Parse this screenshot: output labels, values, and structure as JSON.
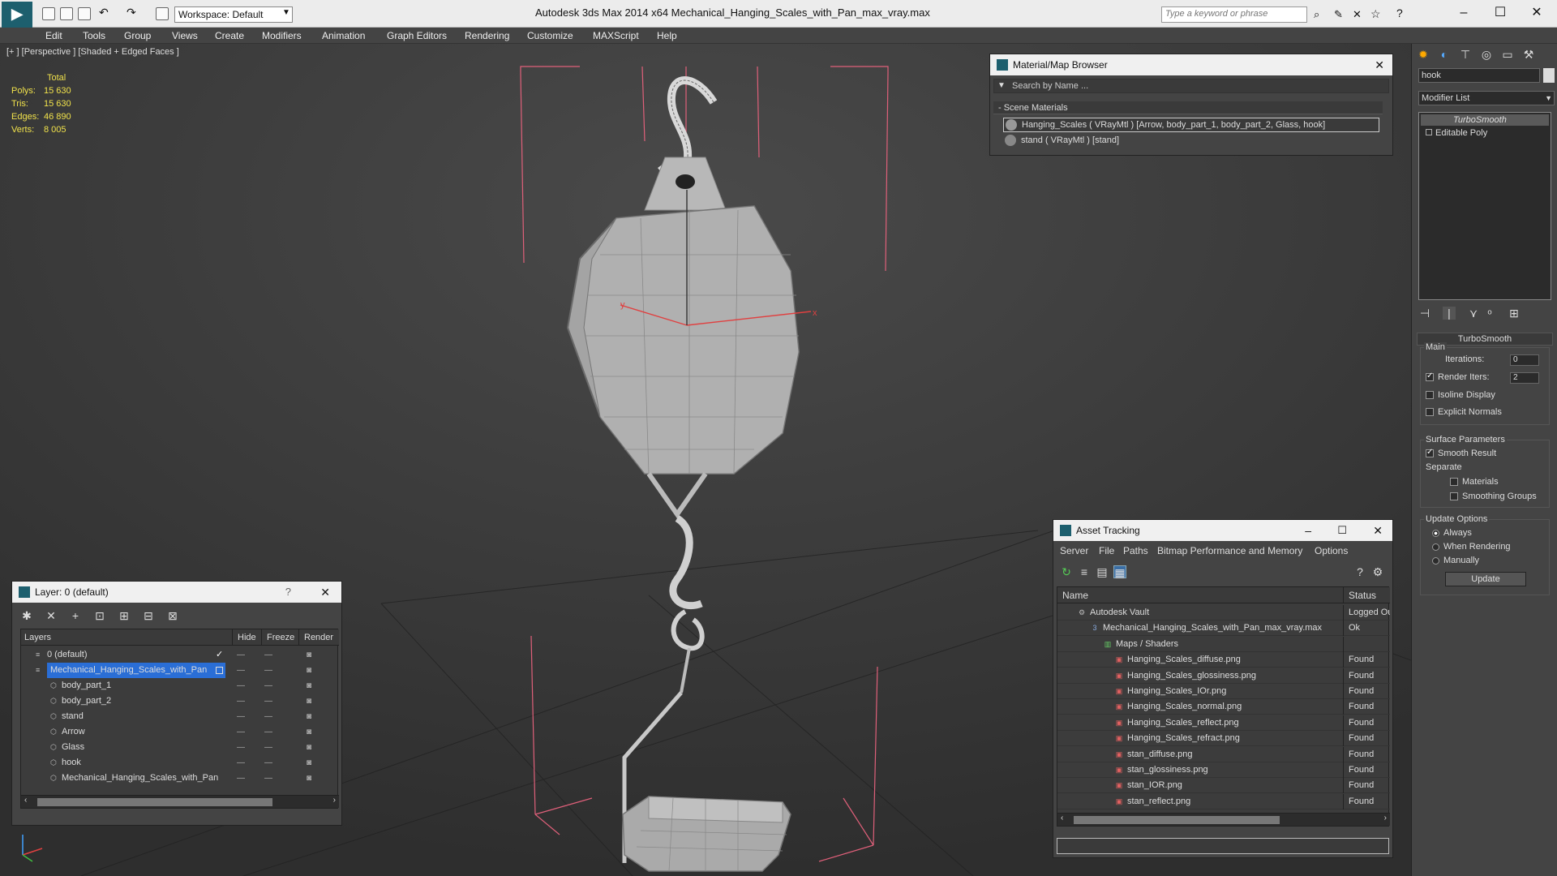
{
  "app": {
    "title": "Autodesk 3ds Max  2014 x64      Mechanical_Hanging_Scales_with_Pan_max_vray.max",
    "workspace_label": "Workspace: Default",
    "search_placeholder": "Type a keyword or phrase"
  },
  "menu": [
    "Edit",
    "Tools",
    "Group",
    "Views",
    "Create",
    "Modifiers",
    "Animation",
    "Graph Editors",
    "Rendering",
    "Customize",
    "MAXScript",
    "Help"
  ],
  "viewport": {
    "label": "[+ ] [Perspective ] [Shaded + Edged Faces ]",
    "stats": {
      "header": "Total",
      "polys_label": "Polys:",
      "polys": "15 630",
      "tris_label": "Tris:",
      "tris": "15 630",
      "edges_label": "Edges:",
      "edges": "46 890",
      "verts_label": "Verts:",
      "verts": "8 005"
    },
    "axis_x": "x",
    "axis_y": "y"
  },
  "material_browser": {
    "title": "Material/Map Browser",
    "search_placeholder": "Search by Name ...",
    "section": "- Scene Materials",
    "items": [
      "Hanging_Scales ( VRayMtl ) [Arrow, body_part_1, body_part_2, Glass, hook]",
      "stand ( VRayMtl ) [stand]"
    ]
  },
  "layer_panel": {
    "title": "Layer: 0 (default)",
    "help": "?",
    "columns": {
      "layers": "Layers",
      "hide": "Hide",
      "freeze": "Freeze",
      "render": "Render"
    },
    "rows": [
      "0 (default)",
      "Mechanical_Hanging_Scales_with_Pan",
      "body_part_1",
      "body_part_2",
      "stand",
      "Arrow",
      "Glass",
      "hook",
      "Mechanical_Hanging_Scales_with_Pan"
    ]
  },
  "asset_tracking": {
    "title": "Asset Tracking",
    "menu": [
      "Server",
      "File",
      "Paths",
      "Bitmap Performance and Memory",
      "Options"
    ],
    "columns": {
      "name": "Name",
      "status": "Status"
    },
    "rows": [
      {
        "name": "Autodesk Vault",
        "status": "Logged Ou"
      },
      {
        "name": "Mechanical_Hanging_Scales_with_Pan_max_vray.max",
        "status": "Ok"
      },
      {
        "name": "Maps / Shaders",
        "status": ""
      },
      {
        "name": "Hanging_Scales_diffuse.png",
        "status": "Found"
      },
      {
        "name": "Hanging_Scales_glossiness.png",
        "status": "Found"
      },
      {
        "name": "Hanging_Scales_IOr.png",
        "status": "Found"
      },
      {
        "name": "Hanging_Scales_normal.png",
        "status": "Found"
      },
      {
        "name": "Hanging_Scales_reflect.png",
        "status": "Found"
      },
      {
        "name": "Hanging_Scales_refract.png",
        "status": "Found"
      },
      {
        "name": "stan_diffuse.png",
        "status": "Found"
      },
      {
        "name": "stan_glossiness.png",
        "status": "Found"
      },
      {
        "name": "stan_IOR.png",
        "status": "Found"
      },
      {
        "name": "stan_reflect.png",
        "status": "Found"
      }
    ]
  },
  "command_panel": {
    "object_name": "hook",
    "modifier_list": "Modifier List",
    "stack": [
      "TurboSmooth",
      "Editable Poly"
    ],
    "rollout_title": "TurboSmooth",
    "main_group": "Main",
    "iterations_label": "Iterations:",
    "iterations": "0",
    "render_iters_label": "Render Iters:",
    "render_iters": "2",
    "isoline": "Isoline Display",
    "explicit_normals": "Explicit Normals",
    "surface_params": "Surface Parameters",
    "smooth_result": "Smooth Result",
    "separate": "Separate",
    "materials": "Materials",
    "smoothing_groups": "Smoothing Groups",
    "update_options": "Update Options",
    "always": "Always",
    "when_rendering": "When Rendering",
    "manually": "Manually",
    "update_button": "Update"
  }
}
